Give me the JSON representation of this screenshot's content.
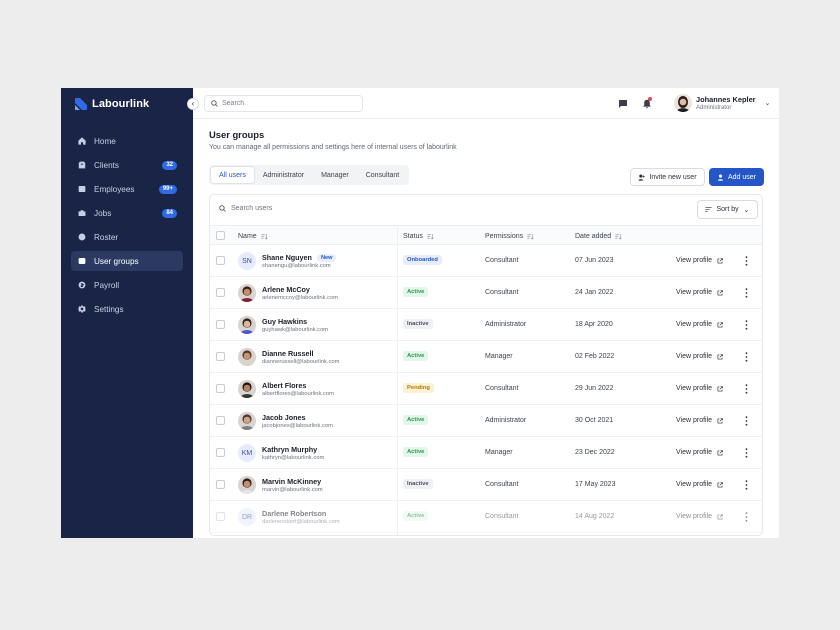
{
  "brand": {
    "name": "Labourlink",
    "color": "#2f6be6"
  },
  "sidebar": {
    "items": [
      {
        "label": "Home",
        "icon": "home-icon",
        "badge": ""
      },
      {
        "label": "Clients",
        "icon": "clients-icon",
        "badge": "32"
      },
      {
        "label": "Employees",
        "icon": "employees-icon",
        "badge": "99+"
      },
      {
        "label": "Jobs",
        "icon": "briefcase-icon",
        "badge": "84"
      },
      {
        "label": "Roster",
        "icon": "roster-icon",
        "badge": ""
      },
      {
        "label": "User groups",
        "icon": "user-groups-icon",
        "badge": "",
        "active": true
      },
      {
        "label": "Payroll",
        "icon": "payroll-icon",
        "badge": ""
      },
      {
        "label": "Settings",
        "icon": "gear-icon",
        "badge": ""
      }
    ]
  },
  "topbar": {
    "search_placeholder": "Search",
    "user": {
      "name": "Johannes Kepler",
      "role": "Administrator"
    }
  },
  "page": {
    "title": "User groups",
    "subtitle": "You can manage all permissions and settings here of internal users of labourlink",
    "tabs": [
      "All users",
      "Administrator",
      "Manager",
      "Consultant"
    ],
    "active_tab": 0,
    "invite_label": "Invite new user",
    "add_label": "Add user"
  },
  "table": {
    "search_placeholder": "Search users",
    "sort_label": "Sort by",
    "columns": {
      "name": "Name",
      "status": "Status",
      "permissions": "Permissions",
      "date": "Date added"
    },
    "view_label": "View profile",
    "rows": [
      {
        "name": "Shane Nguyen",
        "badge": "New",
        "email": "shanengu@labourlink.com",
        "status": "Onboarded",
        "status_type": "onboarded",
        "permissions": "Consultant",
        "date": "07 Jun 2023",
        "avatar": "initials",
        "initials": "SN"
      },
      {
        "name": "Arlene McCoy",
        "badge": "",
        "email": "arlenemccoy@labourlink.com",
        "status": "Active",
        "status_type": "active",
        "permissions": "Consultant",
        "date": "24 Jan 2022",
        "avatar": "photo",
        "skin": "#c98c6b",
        "hair": "#3a1f1a",
        "shirt": "#8b1e2e"
      },
      {
        "name": "Guy Hawkins",
        "badge": "",
        "email": "guyhawk@labourlink.com",
        "status": "Inactive",
        "status_type": "inactive",
        "permissions": "Administrator",
        "date": "18 Apr 2020",
        "avatar": "photo",
        "skin": "#e0b69a",
        "hair": "#2b2320",
        "shirt": "#4b56c8"
      },
      {
        "name": "Dianne Russell",
        "badge": "",
        "email": "diannerussell@labourlink.com",
        "status": "Active",
        "status_type": "active",
        "permissions": "Manager",
        "date": "02 Feb 2022",
        "avatar": "photo",
        "skin": "#c79573",
        "hair": "#5b3a2a",
        "shirt": "#d9d3c8"
      },
      {
        "name": "Albert Flores",
        "badge": "",
        "email": "albertflores@labourlink.com",
        "status": "Pending",
        "status_type": "pending",
        "permissions": "Consultant",
        "date": "29 Jun 2022",
        "avatar": "photo",
        "skin": "#b98462",
        "hair": "#1d1715",
        "shirt": "#2c3a2f"
      },
      {
        "name": "Jacob Jones",
        "badge": "",
        "email": "jacobjones@labourlink.com",
        "status": "Active",
        "status_type": "active",
        "permissions": "Administrator",
        "date": "30 Oct 2021",
        "avatar": "photo",
        "skin": "#d2a487",
        "hair": "#4a3a33",
        "shirt": "#7a7f88"
      },
      {
        "name": "Kathryn Murphy",
        "badge": "",
        "email": "kathryn@labourlink.com",
        "status": "Active",
        "status_type": "active",
        "permissions": "Manager",
        "date": "23 Dec 2022",
        "avatar": "initials",
        "initials": "KM"
      },
      {
        "name": "Marvin McKinney",
        "badge": "",
        "email": "marvin@labourlink.com",
        "status": "Inactive",
        "status_type": "inactive",
        "permissions": "Consultant",
        "date": "17 May 2023",
        "avatar": "photo",
        "skin": "#c2906f",
        "hair": "#2a1e1a",
        "shirt": "#e8e6e2"
      },
      {
        "name": "Darlene Robertson",
        "badge": "",
        "email": "darlenerobert@labourlink.com",
        "status": "Active",
        "status_type": "active",
        "permissions": "Consultant",
        "date": "14 Aug 2022",
        "avatar": "initials",
        "initials": "DR",
        "faded": true
      }
    ]
  },
  "colors": {
    "accent": "#2456c8",
    "sidebar_bg": "#1a2447",
    "sidebar_active": "#2c3a63"
  }
}
